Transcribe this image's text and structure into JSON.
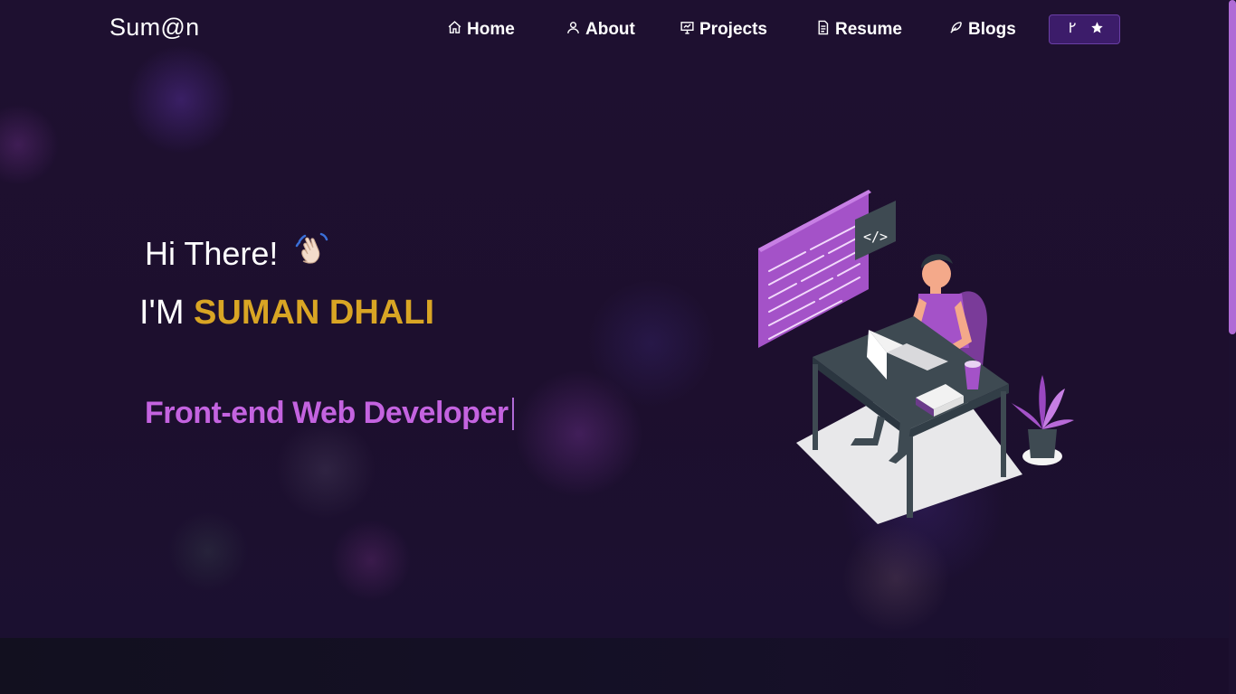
{
  "brand": "Sum@n",
  "nav": {
    "items": [
      {
        "label": "Home",
        "icon": "home-icon"
      },
      {
        "label": "About",
        "icon": "user-icon"
      },
      {
        "label": "Projects",
        "icon": "presentation-icon"
      },
      {
        "label": "Resume",
        "icon": "document-icon"
      },
      {
        "label": "Blogs",
        "icon": "feather-icon"
      }
    ],
    "github_button_icons": [
      "git-fork-icon",
      "star-icon"
    ]
  },
  "hero": {
    "greeting": "Hi There!",
    "greeting_emoji_icon": "waving-hand-icon",
    "name_prefix": "I'M ",
    "name": "SUMAN DHALI",
    "typed_text": "Front-end Web Developer",
    "illustration_code_label": "</>"
  },
  "colors": {
    "accent_purple": "#c463e0",
    "name_gold": "#d9a524",
    "button_bg": "#3c1c6a"
  }
}
